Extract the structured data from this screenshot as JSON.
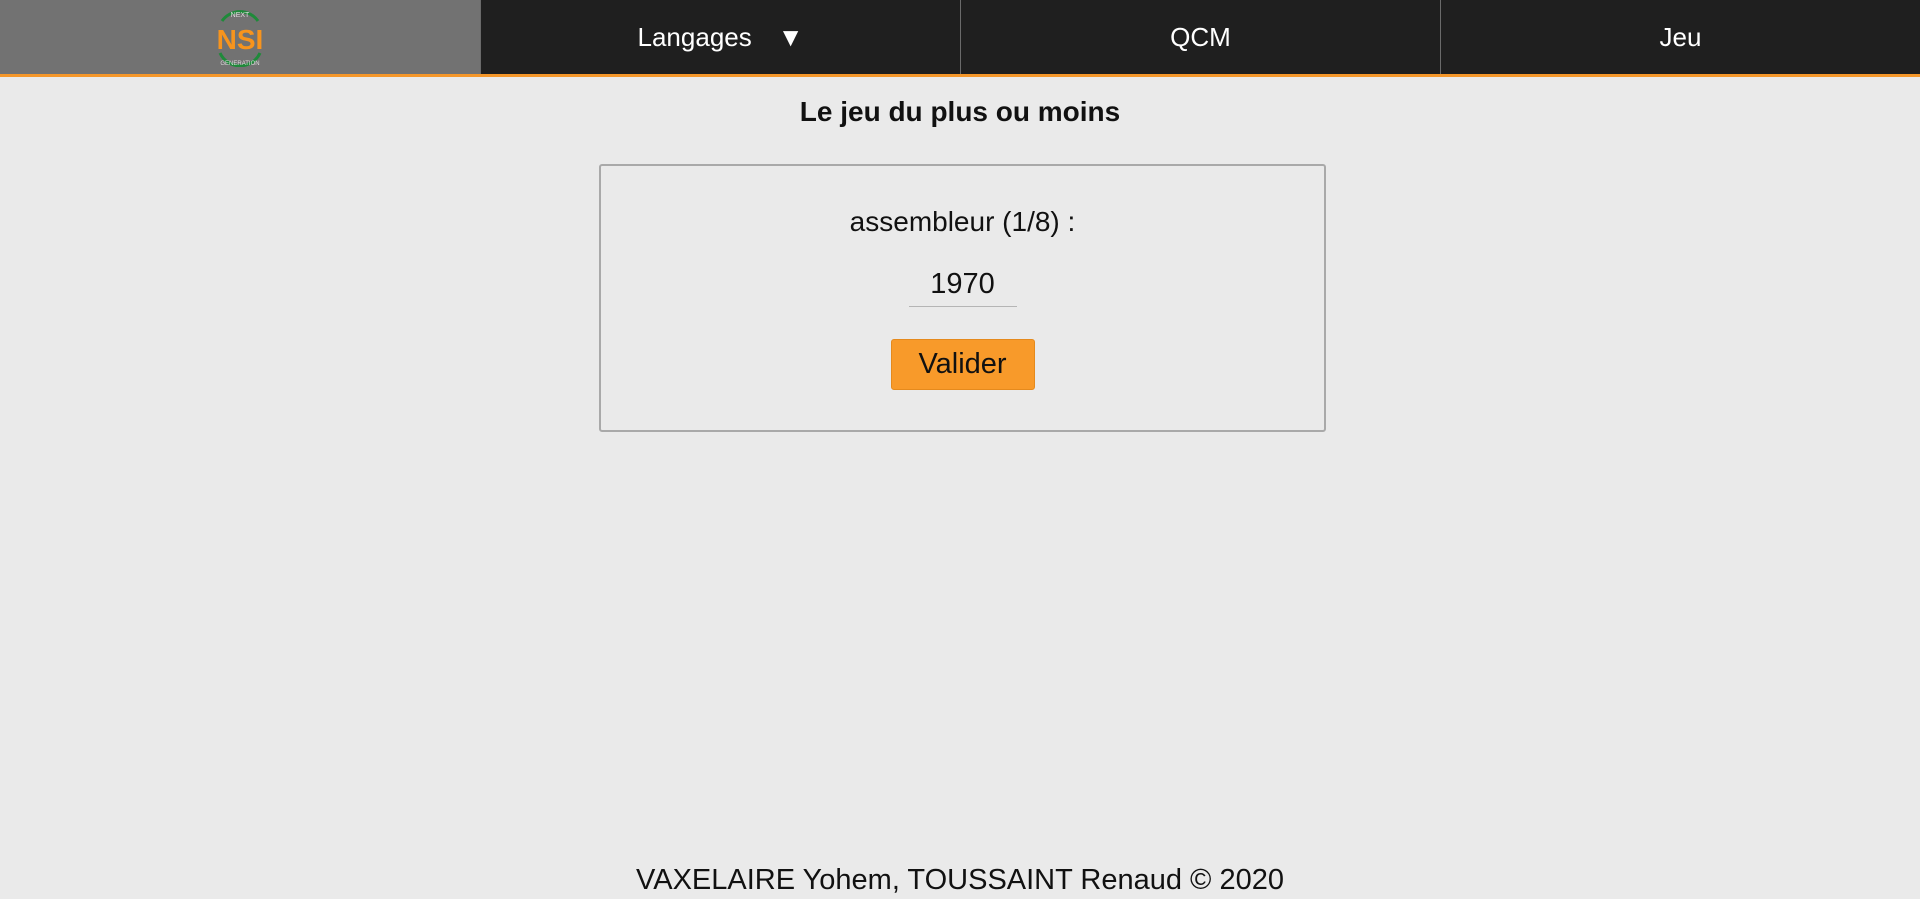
{
  "nav": {
    "logo": {
      "icon": "nsi-next-generation-logo",
      "top_text": "NEXT",
      "letters": "NSI",
      "bottom_text": "GENERATION",
      "colors": {
        "orange": "#f7941d",
        "green": "#1f8a3a"
      }
    },
    "items": [
      {
        "label": "Langages",
        "caret": "▼"
      },
      {
        "label": "QCM"
      },
      {
        "label": "Jeu"
      }
    ],
    "accent_color": "#f5972a"
  },
  "page": {
    "title": "Le jeu du plus ou moins"
  },
  "game": {
    "question": "assembleur (1/8) :",
    "answer_value": "1970",
    "button_label": "Valider",
    "button_color": "#f89a2a"
  },
  "footer": {
    "text": "VAXELAIRE Yohem, TOUSSAINT Renaud © 2020"
  }
}
